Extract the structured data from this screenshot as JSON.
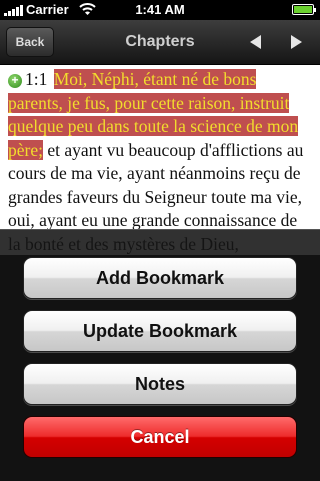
{
  "status_bar": {
    "carrier": "Carrier",
    "time": "1:41 AM",
    "icons": [
      "signal-bars",
      "wifi",
      "battery"
    ]
  },
  "nav": {
    "back_label": "Back",
    "title": "Chapters",
    "icons": [
      "arrow-left",
      "arrow-right"
    ]
  },
  "content": {
    "verse_number": "1:1",
    "highlighted_text": "Moi, Néphi, étant né de bons parents, je fus, pour cette raison, instruit quelque peu dans toute la science de mon père;",
    "rest_text": "et ayant vu beaucoup d'afflictions au cours de ma vie, ayant néanmoins reçu de grandes faveurs du Seigneur toute ma vie, oui, ayant eu une grande connaissance de la bonté et des mystères de Dieu,",
    "highlight_background": "#bf4f4f",
    "highlight_text_color": "#f2dd2d"
  },
  "action_sheet": {
    "add_bookmark": "Add Bookmark",
    "update_bookmark": "Update Bookmark",
    "notes": "Notes",
    "cancel": "Cancel",
    "cancel_color": "#e00000"
  }
}
